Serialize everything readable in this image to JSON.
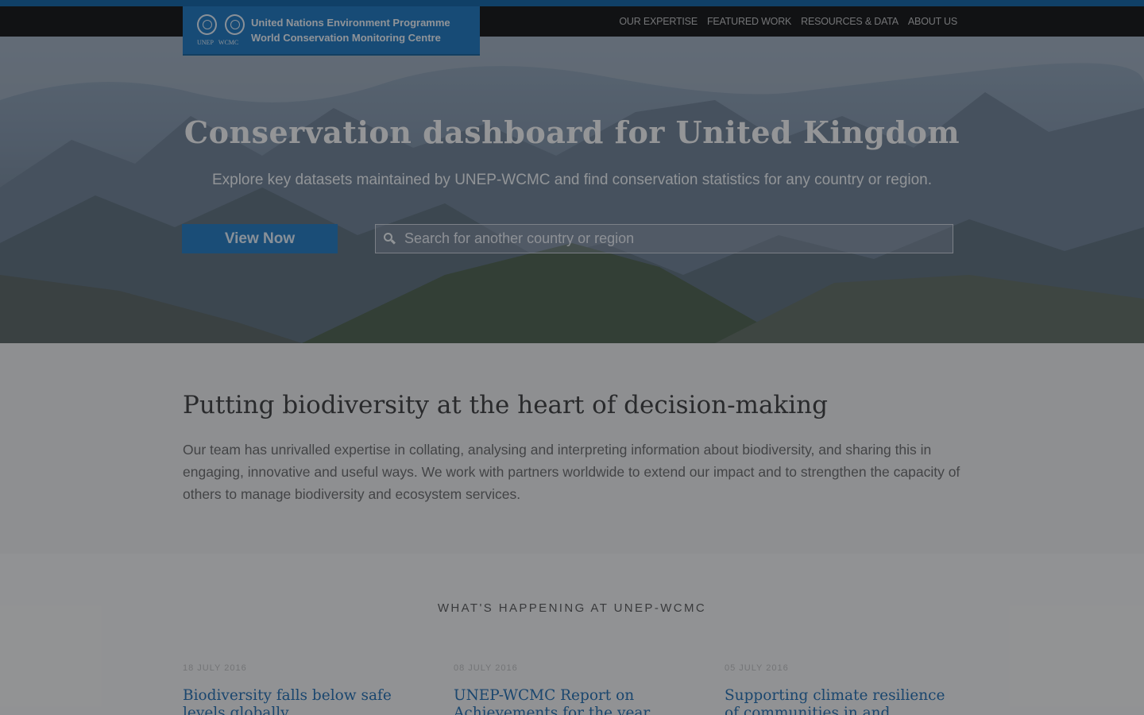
{
  "header": {
    "logo_line1": "United Nations Environment Programme",
    "logo_line2": "World Conservation Monitoring Centre",
    "logo_mark_left": "UNEP",
    "logo_mark_right": "WCMC",
    "nav": [
      "OUR EXPERTISE",
      "FEATURED WORK",
      "RESOURCES & DATA",
      "ABOUT US"
    ]
  },
  "hero": {
    "title": "Conservation dashboard for United Kingdom",
    "subtitle": "Explore key datasets maintained by UNEP-WCMC and find conservation statistics for any country or region.",
    "button_label": "View Now",
    "search_placeholder": "Search for another country or region"
  },
  "intro": {
    "heading": "Putting biodiversity at the heart of decision-making",
    "body": "Our team has unrivalled expertise in collating, analysing and interpreting information about biodiversity, and sharing this in engaging, innovative and useful ways. We work with partners worldwide to extend our impact and to strengthen the capacity of others to manage biodiversity and ecosystem services."
  },
  "news": {
    "heading": "WHAT'S HAPPENING AT UNEP-WCMC",
    "items": [
      {
        "date": "18 JULY 2016",
        "title": "Biodiversity falls below safe levels globally"
      },
      {
        "date": "08 JULY 2016",
        "title": "UNEP-WCMC Report on Achievements for the year"
      },
      {
        "date": "05 JULY 2016",
        "title": "Supporting climate resilience of communities in and"
      }
    ]
  },
  "colors": {
    "brand_blue": "#1b73b8",
    "nav_bg": "#111111",
    "link_blue": "#1f69ab",
    "top_strip": "#0f5f9f"
  },
  "icons": [
    "search-icon",
    "un-emblem-icon",
    "wcmc-emblem-icon"
  ]
}
